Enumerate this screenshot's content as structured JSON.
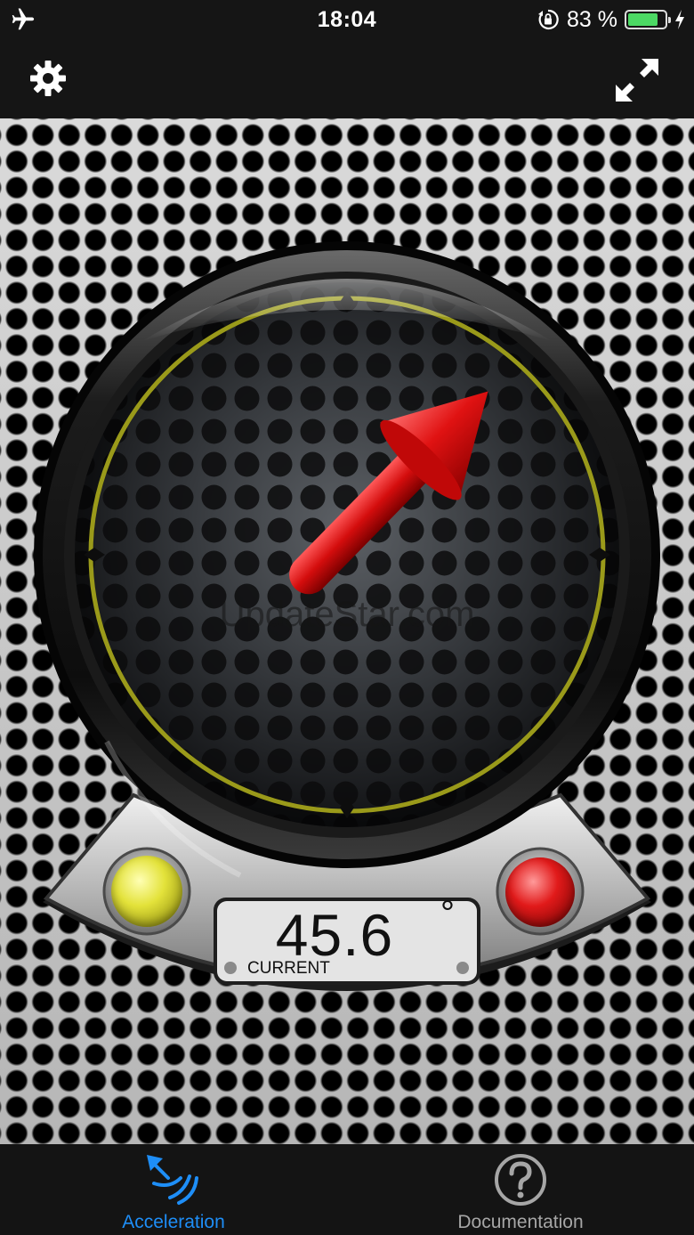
{
  "status_bar": {
    "time": "18:04",
    "battery_percent": "83 %",
    "battery_level": 0.83,
    "icons": [
      "airplane-mode-icon",
      "orientation-lock-icon",
      "battery-icon",
      "charging-bolt-icon"
    ]
  },
  "nav_bar": {
    "left_icon": "gear-icon",
    "right_icon": "expand-fullscreen-icon"
  },
  "gauge": {
    "needle_angle_deg": 45.6,
    "readout_value": "45.6",
    "readout_unit": "°",
    "readout_label": "CURRENT",
    "left_light": "yellow",
    "right_light": "red",
    "ring_color": "#9a9a1a",
    "needle_color": "#e01010"
  },
  "watermark": "UpdateStar.com",
  "tabs": [
    {
      "label": "Acceleration",
      "icon": "acceleration-arrows-icon",
      "active": true,
      "color": "#1e8ef7"
    },
    {
      "label": "Documentation",
      "icon": "question-mark-icon",
      "active": false,
      "color": "#a6a6a6"
    }
  ]
}
